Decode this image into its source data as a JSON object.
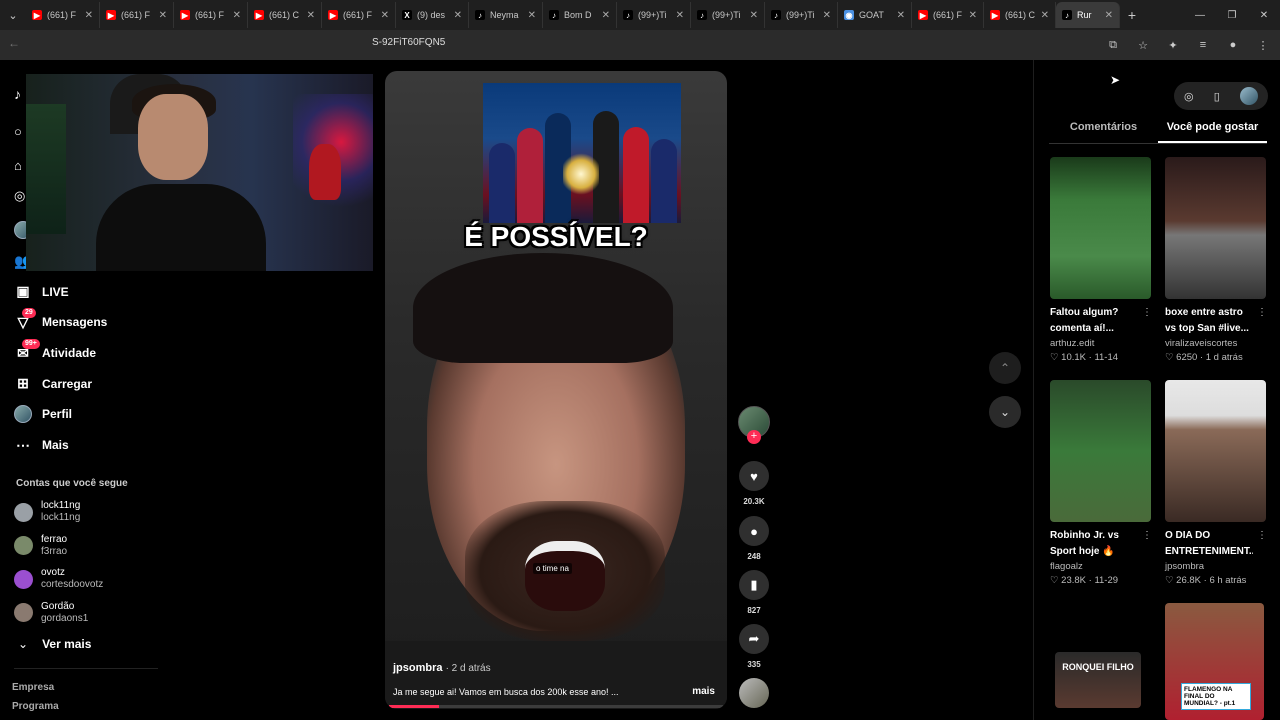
{
  "tabs": [
    {
      "title": "(661) F",
      "icon": "youtube-icon",
      "color": "#ff0000"
    },
    {
      "title": "(661) F",
      "icon": "youtube-icon",
      "color": "#ff0000"
    },
    {
      "title": "(661) F",
      "icon": "youtube-icon",
      "color": "#ff0000"
    },
    {
      "title": "(661) C",
      "icon": "youtube-icon",
      "color": "#ff0000"
    },
    {
      "title": "(661) F",
      "icon": "youtube-icon",
      "color": "#ff0000"
    },
    {
      "title": "(9) des",
      "icon": "x-icon",
      "color": "#000000"
    },
    {
      "title": "Neyma",
      "icon": "tiktok-icon",
      "color": "#000000"
    },
    {
      "title": "Bom D",
      "icon": "tiktok-icon",
      "color": "#000000"
    },
    {
      "title": "(99+)Ti",
      "icon": "tiktok-icon",
      "color": "#000000"
    },
    {
      "title": "(99+)Ti",
      "icon": "tiktok-icon",
      "color": "#000000"
    },
    {
      "title": "(99+)Ti",
      "icon": "tiktok-icon",
      "color": "#000000"
    },
    {
      "title": "GOAT",
      "icon": "globe-icon",
      "color": "#4a90e2"
    },
    {
      "title": "(661) F",
      "icon": "youtube-icon",
      "color": "#ff0000"
    },
    {
      "title": "(661) C",
      "icon": "youtube-icon",
      "color": "#ff0000"
    },
    {
      "title": "Rur",
      "icon": "tiktok-icon",
      "color": "#000000",
      "active": true
    }
  ],
  "address": {
    "url": "S-92FiT60FQN5"
  },
  "sidebar": {
    "nav": [
      {
        "label": "Seguindo",
        "icon": "following-avatar-icon"
      },
      {
        "label": "Amigos",
        "icon": "friends-icon"
      },
      {
        "label": "LIVE",
        "icon": "live-icon"
      },
      {
        "label": "Mensagens",
        "icon": "messages-icon",
        "badge": "29"
      },
      {
        "label": "Atividade",
        "icon": "activity-icon",
        "badge": "99+"
      },
      {
        "label": "Carregar",
        "icon": "upload-icon"
      },
      {
        "label": "Perfil",
        "icon": "profile-avatar-icon"
      },
      {
        "label": "Mais",
        "icon": "more-icon"
      }
    ],
    "following_title": "Contas que você segue",
    "accounts": [
      {
        "name": "lock11ng",
        "handle": "lock11ng",
        "color": "#9aa0a6"
      },
      {
        "name": "ferrao",
        "handle": "f3rrao",
        "color": "#7a8a6a"
      },
      {
        "name": "ovotz",
        "handle": "cortesdoovotz",
        "color": "#9b4fd0"
      },
      {
        "name": "Gordão",
        "handle": "gordaons1",
        "color": "#8a7a70"
      }
    ],
    "see_more": "Ver mais",
    "footer": [
      "Empresa",
      "Programa"
    ]
  },
  "video": {
    "overlay_title": "É POSSÍVEL?",
    "subtitle": "o time na",
    "author": "jpsombra",
    "time": "· 2 d atrás",
    "description": "Ja me segue ai! Vamos em busca dos 200k esse ano! ...",
    "more": "mais",
    "progress": 0.15
  },
  "actions": {
    "likes": "20.3K",
    "comments": "248",
    "saves": "827",
    "shares": "335"
  },
  "right_panel": {
    "tabs": [
      {
        "label": "Comentários",
        "active": false
      },
      {
        "label": "Você pode gostar",
        "active": true
      }
    ],
    "cards": [
      {
        "title1": "Faltou algum?",
        "title2": "comenta aí!...",
        "author": "arthuz.edit",
        "likes": "10.1K",
        "date": "11-14",
        "theme": "field"
      },
      {
        "title1": "boxe entre astro",
        "title2": "vs top San #live...",
        "author": "viralizaveiscortes",
        "likes": "6250",
        "date": "1 d atrás",
        "theme": "boxe"
      },
      {
        "title1": "Robinho Jr. vs",
        "title2": "Sport hoje 🔥",
        "author": "flagoalz",
        "likes": "23.8K",
        "date": "11-29",
        "theme": "player"
      },
      {
        "title1": "O DIA DO",
        "title2": "ENTRETENIMENT...",
        "author": "jpsombra",
        "likes": "26.8K",
        "date": "6 h atrás",
        "theme": "face"
      }
    ],
    "bottom_cards": [
      {
        "label": "RONQUEI FILHO"
      },
      {
        "label": "FLAMENGO NA FINAL DO MUNDIAL? - pt.1"
      }
    ]
  }
}
